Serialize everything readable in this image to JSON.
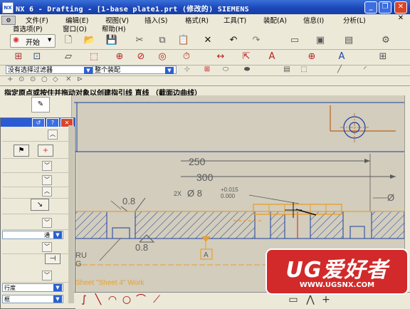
{
  "titlebar": {
    "title": "NX 6 - Drafting - [1-base plate1.prt  (修改的)  SIEMENS",
    "app_icon": "NX",
    "minimize": "_",
    "restore": "❐",
    "close": "✕"
  },
  "menu": {
    "file": "文件(F)",
    "edit": "编辑(E)",
    "view": "视图(V)",
    "insert": "插入(S)",
    "format": "格式(R)",
    "tools": "工具(T)",
    "assembly": "装配(A)",
    "info": "信息(I)",
    "analysis": "分析(L)",
    "preferences": "首选项(P)",
    "window": "窗口(O)",
    "help": "帮助(H)",
    "start": "开始"
  },
  "filters": {
    "selection_filter": "没有选择过滤器",
    "assembly_scope": "整个装配"
  },
  "cue_line": "指定原点或按住并拖动对象以创建指引线  直线  （截面边曲线）",
  "drawing": {
    "dim_250": "250",
    "dim_300": "300",
    "hole_prefix": "2X",
    "hole_dia": "Ø 8",
    "tol_upper": "+0.015",
    "tol_lower": "0.000",
    "rough_1": "0.8",
    "rough_2": "0.8",
    "datum": "A",
    "fragment_1": "RU",
    "fragment_2": "G",
    "sheet_label": "Sheet \"Sheet 4\" Work",
    "phi_right": "Ø"
  },
  "dialog": {
    "row_a": "行度",
    "row_b": "框",
    "row_c": "通",
    "row_d": "行度"
  },
  "watermark": {
    "title": "UG爱好者",
    "url": "WWW.UGSNX.COM"
  },
  "colors": {
    "canvas_bg": "#d2cdbd",
    "geometry": "#1a3ea0",
    "dimension": "#5a5a5a",
    "highlight": "#e8a030",
    "titlebar": "#1c48b8"
  }
}
